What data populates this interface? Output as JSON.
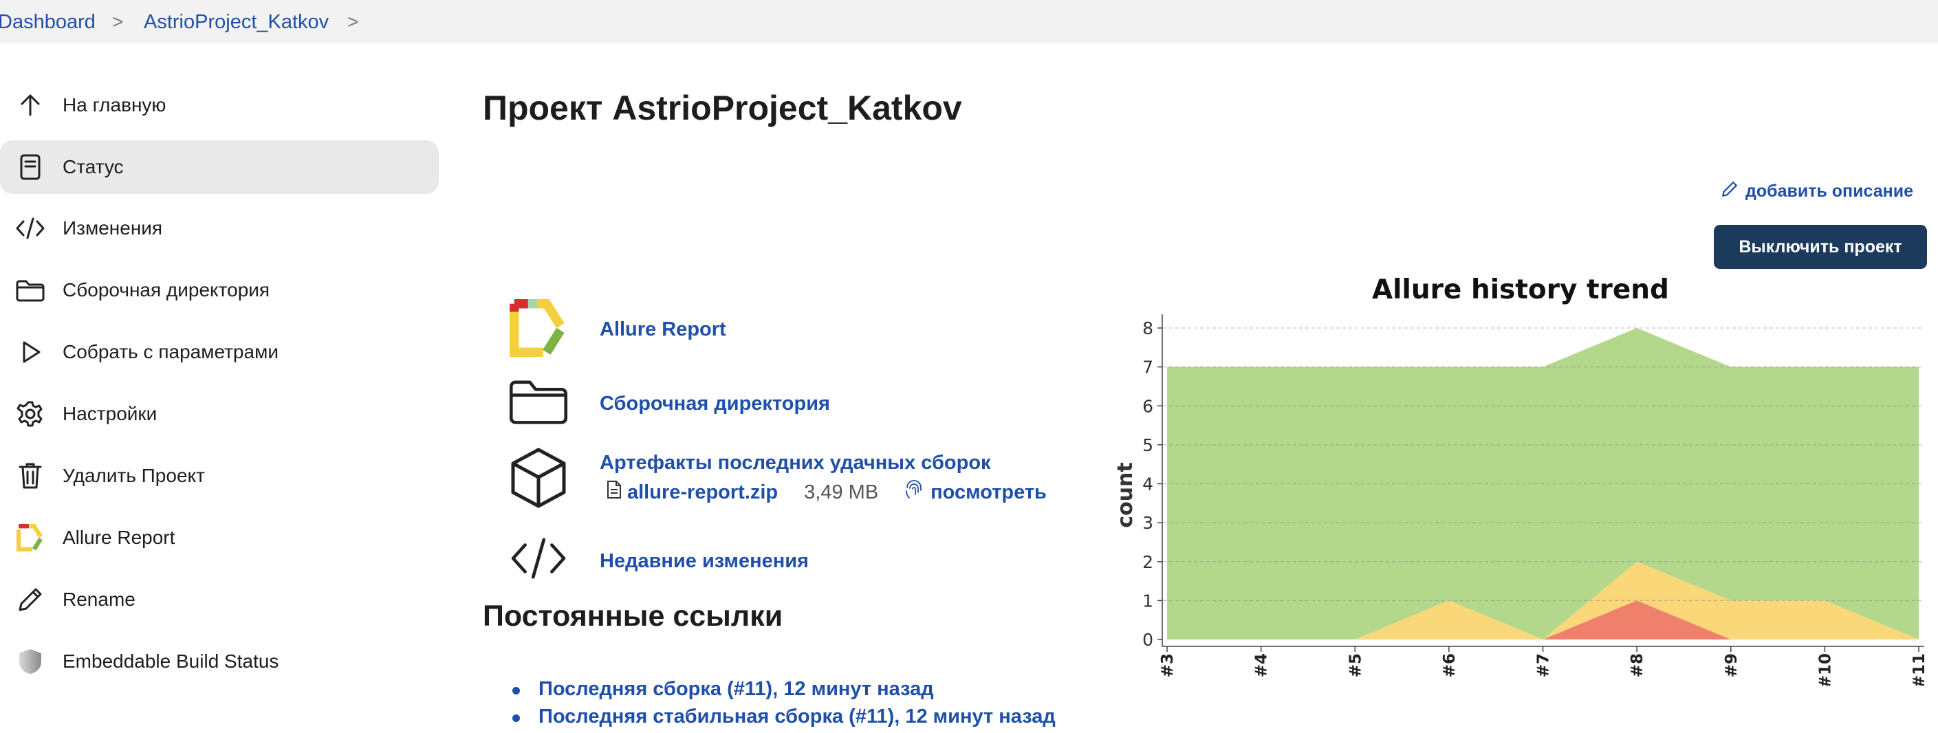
{
  "breadcrumb": {
    "items": [
      "Dashboard",
      "AstrioProject_Katkov"
    ],
    "separator": ">"
  },
  "sidebar": {
    "items": [
      {
        "label": "На главную",
        "icon": "arrow-up-icon"
      },
      {
        "label": "Статус",
        "icon": "document-icon",
        "active": true
      },
      {
        "label": "Изменения",
        "icon": "code-icon"
      },
      {
        "label": "Сборочная директория",
        "icon": "folder-icon"
      },
      {
        "label": "Собрать с параметрами",
        "icon": "play-icon"
      },
      {
        "label": "Настройки",
        "icon": "gear-icon"
      },
      {
        "label": "Удалить Проект",
        "icon": "trash-icon"
      },
      {
        "label": "Allure Report",
        "icon": "allure-logo-icon"
      },
      {
        "label": "Rename",
        "icon": "pencil-icon"
      },
      {
        "label": "Embeddable Build Status",
        "icon": "shield-icon"
      }
    ]
  },
  "main": {
    "title": "Проект AstrioProject_Katkov",
    "add_description": "добавить описание",
    "disable_button": "Выключить проект",
    "links": [
      {
        "label": "Allure Report",
        "icon": "allure-logo-icon"
      },
      {
        "label": "Сборочная директория",
        "icon": "folder-icon"
      },
      {
        "label": "Артефакты последних удачных сборок",
        "icon": "package-icon"
      },
      {
        "label": "Недавние изменения",
        "icon": "code-icon"
      }
    ],
    "artifact": {
      "file": "allure-report.zip",
      "size": "3,49 MB",
      "view": "посмотреть"
    },
    "permalinks_title": "Постоянные ссылки",
    "permalinks": [
      "Последняя сборка (#11), 12 минут назад",
      "Последняя стабильная сборка (#11), 12 минут назад"
    ]
  },
  "colors": {
    "accent": "#1f4fa8",
    "button_bg": "#1b3a5c",
    "passed": "#b3d78b",
    "broken": "#fad778",
    "failed": "#ee806c"
  },
  "chart_data": {
    "type": "area",
    "title": "Allure history trend",
    "xlabel": "",
    "ylabel": "count",
    "categories": [
      "#3",
      "#4",
      "#5",
      "#6",
      "#7",
      "#8",
      "#9",
      "#10",
      "#11"
    ],
    "ylim": [
      0,
      8
    ],
    "yticks": [
      0,
      1,
      2,
      3,
      4,
      5,
      6,
      7,
      8
    ],
    "stacked": true,
    "grid": true,
    "series": [
      {
        "key": "failed",
        "values": [
          0,
          0,
          0,
          0,
          0,
          1,
          0,
          0,
          0
        ],
        "color": "#ee806c"
      },
      {
        "key": "broken",
        "values": [
          0,
          0,
          0,
          1,
          0,
          1,
          1,
          1,
          0
        ],
        "color": "#fad778"
      },
      {
        "key": "passed",
        "values": [
          7,
          7,
          7,
          6,
          7,
          6,
          6,
          6,
          7
        ],
        "color": "#b3d78b"
      }
    ]
  }
}
